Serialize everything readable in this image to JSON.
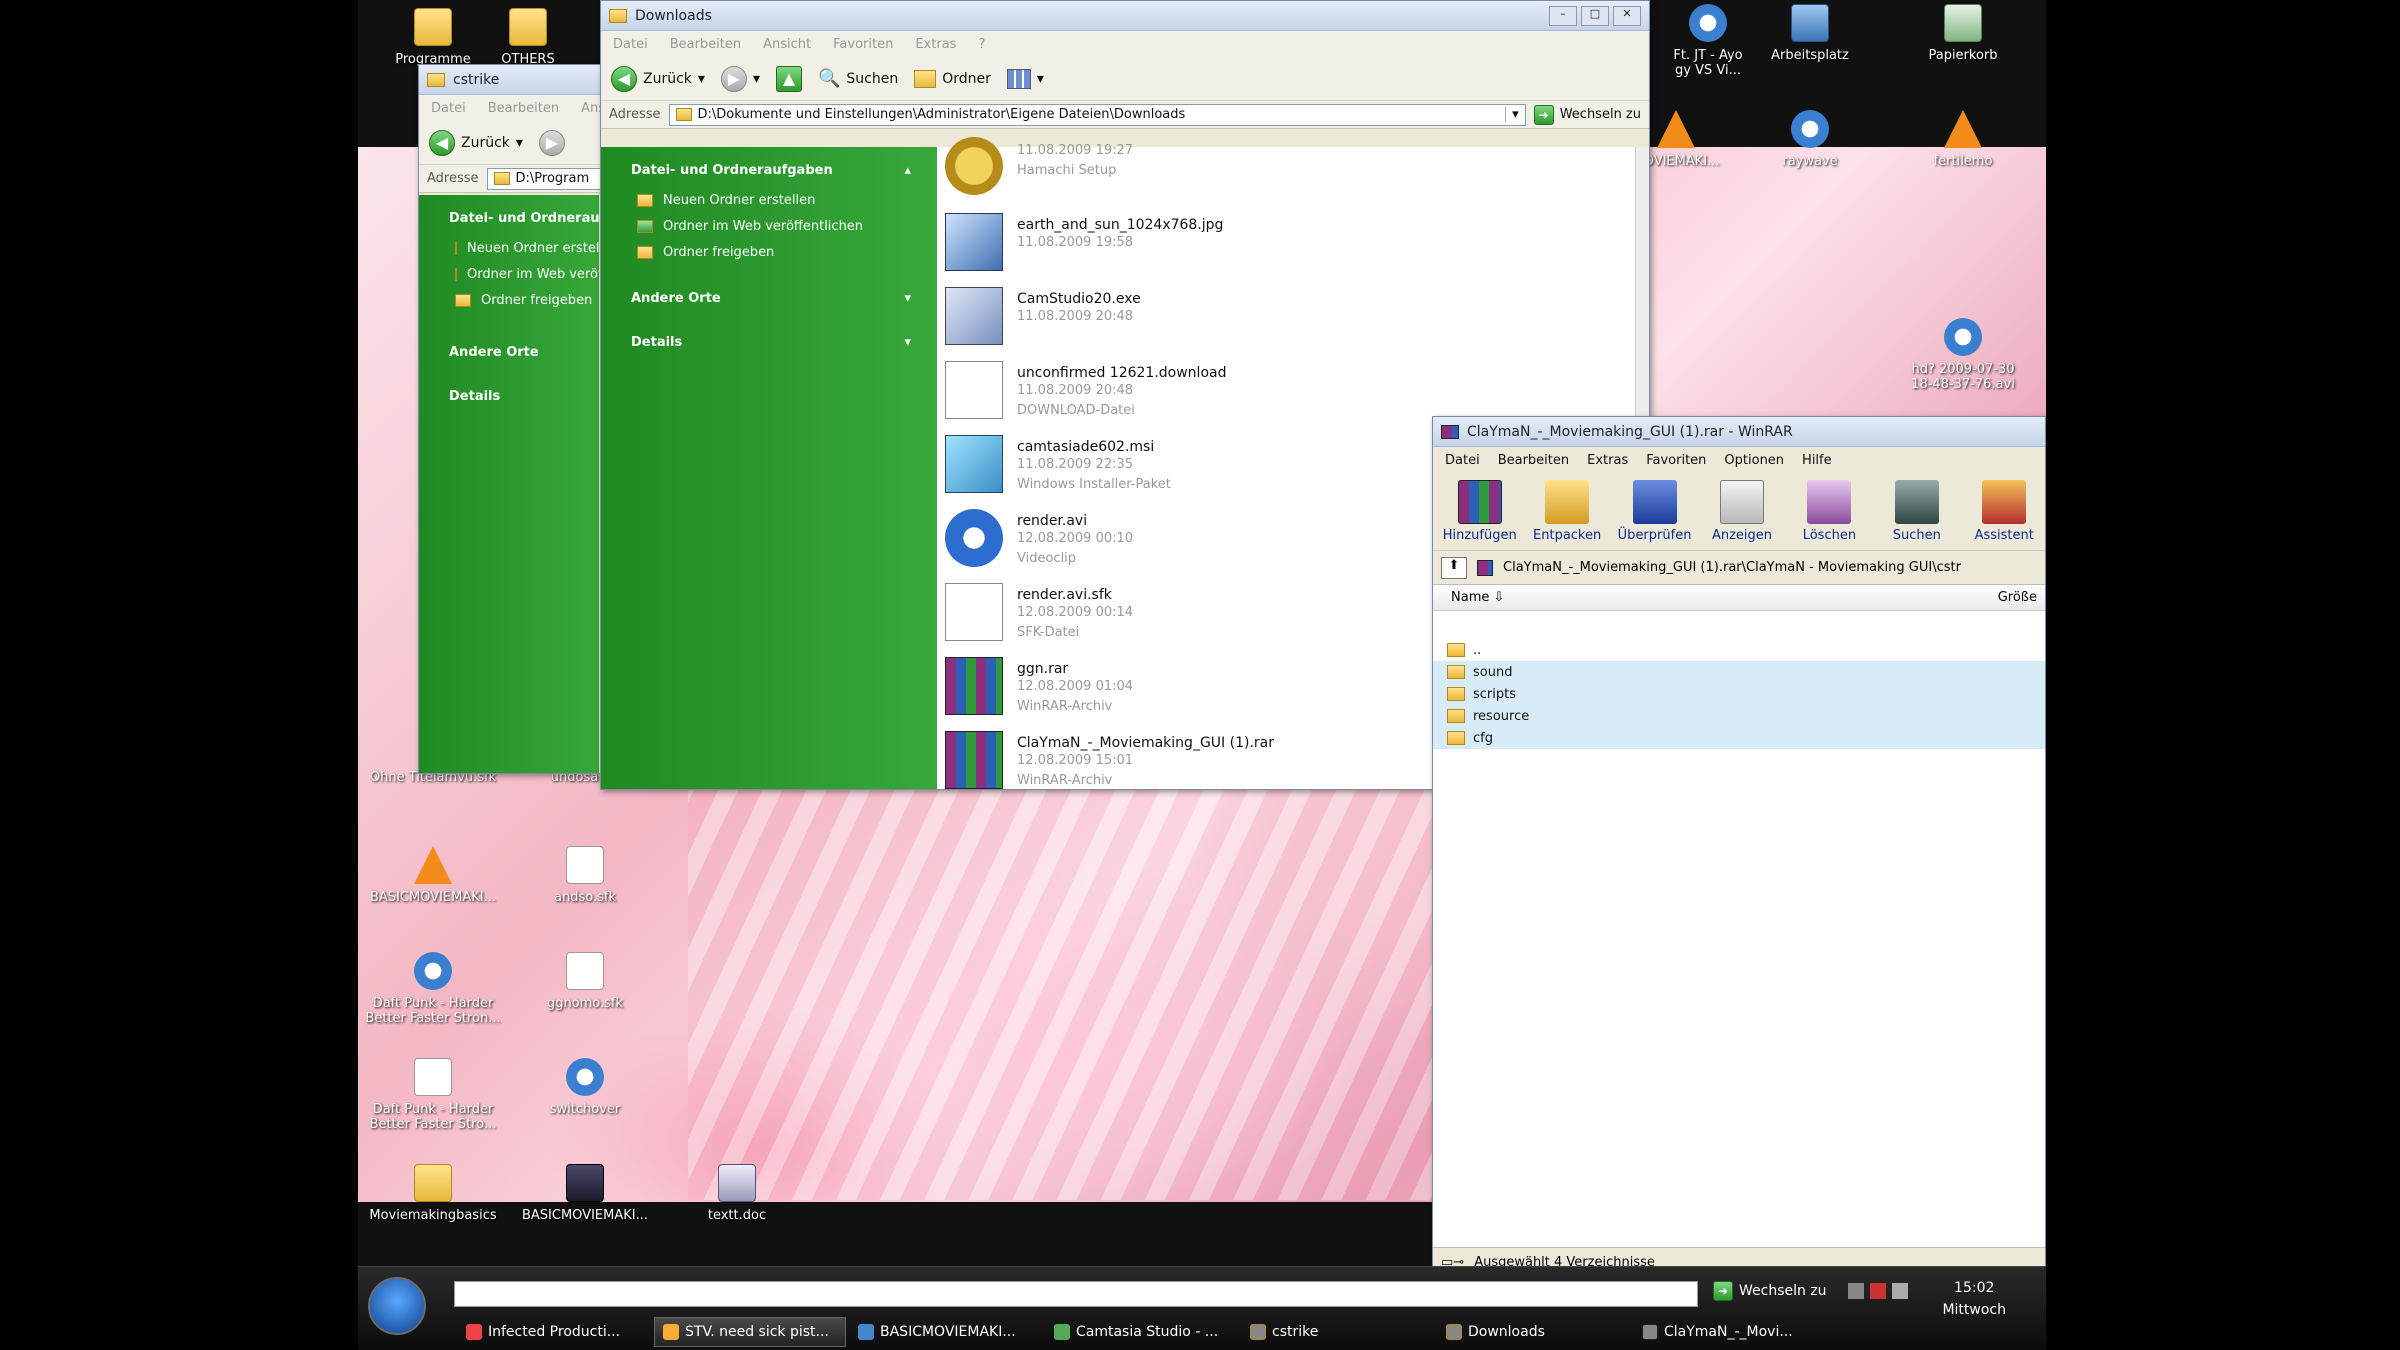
{
  "desktop": {
    "icons": [
      {
        "label": "Programme",
        "kind": "folder"
      },
      {
        "label": "OTHERS",
        "kind": "folder"
      },
      {
        "label": "Ft. JT - Ayo\ngy VS Vi...",
        "kind": "media"
      },
      {
        "label": "Arbeitsplatz",
        "kind": "pc"
      },
      {
        "label": "Papierkorb",
        "kind": "bin"
      },
      {
        "label": "Ohne Titelamvu.sfk",
        "kind": "doc"
      },
      {
        "label": "undosaver",
        "kind": "doc"
      },
      {
        "label": "BASICMOVIEMAKI...",
        "kind": "vlc"
      },
      {
        "label": "andso.sfk",
        "kind": "doc"
      },
      {
        "label": "Daft Punk - Harder\nBetter Faster Stron...",
        "kind": "media"
      },
      {
        "label": "ggnomo.sfk",
        "kind": "doc"
      },
      {
        "label": "Daft Punk - Harder\nBetter Faster Stro...",
        "kind": "doc"
      },
      {
        "label": "switchover",
        "kind": "media"
      },
      {
        "label": "Moviemakingbasics",
        "kind": "folder"
      },
      {
        "label": "BASICMOVIEMAKI...",
        "kind": "app"
      },
      {
        "label": "textt.doc",
        "kind": "word"
      },
      {
        "label": "raywave",
        "kind": "media"
      },
      {
        "label": "fertilemo",
        "kind": "vlc"
      },
      {
        "label": "MOVIEMAKI...",
        "kind": "vlc"
      },
      {
        "label": "hd? 2009-07-30\n18-48-37-76.avi",
        "kind": "media"
      }
    ]
  },
  "cstrike_window": {
    "title": "cstrike",
    "menu": [
      "Datei",
      "Bearbeiten",
      "Ansicht"
    ],
    "back_label": "Zurück",
    "address_label": "Adresse",
    "address_value": "D:\\Program",
    "tasks_header": "Datei- und Ordneraufgaben",
    "tasks": [
      "Neuen Ordner erstellen",
      "Ordner im Web veröffentlichen",
      "Ordner freigeben"
    ],
    "other_places": "Andere Orte",
    "details": "Details"
  },
  "downloads_window": {
    "title": "Downloads",
    "menu": [
      "Datei",
      "Bearbeiten",
      "Ansicht",
      "Favoriten",
      "Extras",
      "?"
    ],
    "toolbar": {
      "back": "Zurück",
      "search": "Suchen",
      "folders": "Ordner"
    },
    "address_label": "Adresse",
    "address_value": "D:\\Dokumente und Einstellungen\\Administrator\\Eigene Dateien\\Downloads",
    "go_label": "Wechseln zu",
    "tasks_header": "Datei- und Ordneraufgaben",
    "tasks": [
      "Neuen Ordner erstellen",
      "Ordner im Web veröffentlichen",
      "Ordner freigeben"
    ],
    "other_places": "Andere Orte",
    "details": "Details",
    "files": [
      {
        "name": "",
        "meta1": "11.08.2009 19:27",
        "meta2": "Hamachi Setup",
        "icon": "cog"
      },
      {
        "name": "earth_and_sun_1024x768.jpg",
        "meta1": "11.08.2009 19:58",
        "meta2": "",
        "icon": "jpg"
      },
      {
        "name": "CamStudio20.exe",
        "meta1": "11.08.2009 20:48",
        "meta2": "",
        "icon": "exe"
      },
      {
        "name": "unconfirmed 12621.download",
        "meta1": "11.08.2009 20:48",
        "meta2": "DOWNLOAD-Datei",
        "icon": "gen"
      },
      {
        "name": "camtasiade602.msi",
        "meta1": "11.08.2009 22:35",
        "meta2": "Windows Installer-Paket",
        "icon": "msi"
      },
      {
        "name": "render.avi",
        "meta1": "12.08.2009 00:10",
        "meta2": "Videoclip",
        "icon": "avi"
      },
      {
        "name": "render.avi.sfk",
        "meta1": "12.08.2009 00:14",
        "meta2": "SFK-Datei",
        "icon": "gen"
      },
      {
        "name": "ggn.rar",
        "meta1": "12.08.2009 01:04",
        "meta2": "WinRAR-Archiv",
        "icon": "rar"
      },
      {
        "name": "ClaYmaN_-_Moviemaking_GUI (1).rar",
        "meta1": "12.08.2009 15:01",
        "meta2": "WinRAR-Archiv",
        "icon": "rar"
      }
    ]
  },
  "winrar_window": {
    "title": "ClaYmaN_-_Moviemaking_GUI (1).rar - WinRAR",
    "menu": [
      "Datei",
      "Bearbeiten",
      "Extras",
      "Favoriten",
      "Optionen",
      "Hilfe"
    ],
    "tools": [
      "Hinzufügen",
      "Entpacken",
      "Überprüfen",
      "Anzeigen",
      "Löschen",
      "Suchen",
      "Assistent"
    ],
    "path": "ClaYmaN_-_Moviemaking_GUI (1).rar\\ClaYmaN - Moviemaking GUI\\cstr",
    "col_name": "Name",
    "col_size": "Größe",
    "rows": [
      "..",
      "sound",
      "scripts",
      "resource",
      "cfg"
    ],
    "status": "Ausgewählt 4 Verzeichnisse"
  },
  "taskbar": {
    "go_label": "Wechseln zu",
    "tasks": [
      "Infected Producti...",
      "STV. need sick pist...",
      "BASICMOVIEMAKI...",
      "Camtasia Studio - ...",
      "cstrike",
      "Downloads",
      "ClaYmaN_-_Movi..."
    ],
    "clock_time": "15:02",
    "clock_day": "Mittwoch"
  }
}
